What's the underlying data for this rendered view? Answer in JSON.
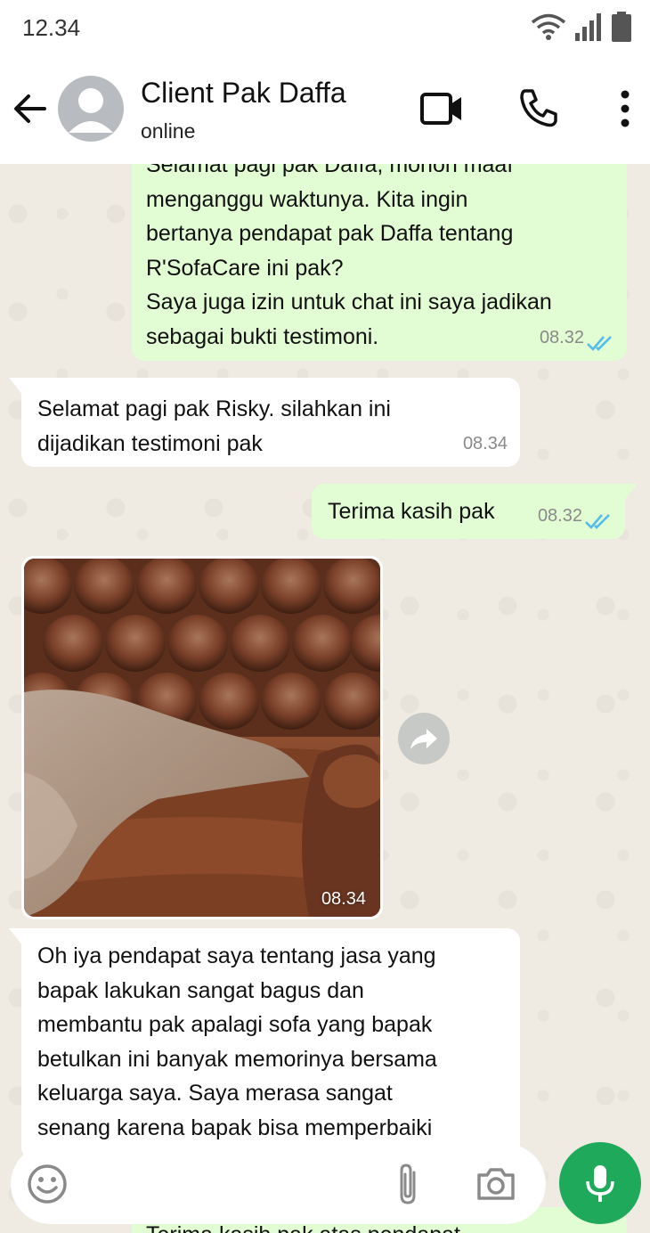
{
  "status_bar": {
    "time": "12.34",
    "icons": [
      "wifi-icon",
      "signal-icon",
      "battery-icon"
    ]
  },
  "header": {
    "contact_name": "Client Pak Daffa",
    "contact_status": "online",
    "icons": [
      "back-arrow-icon",
      "avatar-icon",
      "video-call-icon",
      "phone-call-icon",
      "more-vert-icon"
    ]
  },
  "messages": [
    {
      "direction": "outgoing",
      "lines": [
        "Selamat pagi pak Daffa, mohon maaf",
        "menganggu waktunya. Kita ingin",
        "bertanya pendapat pak Daffa tentang",
        "R'SofaCare ini pak?",
        "Saya juga izin untuk chat ini saya jadikan",
        "sebagai bukti testimoni."
      ],
      "time": "08.32",
      "read": true
    },
    {
      "direction": "incoming",
      "lines": [
        "Selamat pagi pak Risky. silahkan ini",
        "dijadikan testimoni pak"
      ],
      "time": "08.34"
    },
    {
      "direction": "outgoing",
      "lines": [
        "Terima kasih pak"
      ],
      "time": "08.32",
      "read": true
    },
    {
      "direction": "incoming",
      "type": "image",
      "image_subject": "brown tufted leather sofa with a beige throw blanket",
      "time": "08.34"
    },
    {
      "direction": "incoming",
      "lines": [
        "Oh iya pendapat saya tentang jasa yang",
        "bapak lakukan sangat bagus dan",
        "membantu pak apalagi  sofa yang bapak",
        "betulkan ini banyak memorinya bersama",
        "keluarga saya. Saya merasa sangat",
        "senang karena bapak bisa memperbaiki"
      ]
    },
    {
      "direction": "outgoing",
      "lines": [
        "Terima kasih pak atas pendapat"
      ]
    }
  ],
  "composer": {
    "icons": [
      "emoji-icon",
      "attachment-icon",
      "camera-icon",
      "microphone-icon"
    ]
  },
  "colors": {
    "outgoing_bubble": "#e2fcd3",
    "incoming_bubble": "#ffffff",
    "chat_background": "#efeae2",
    "read_tick": "#53bdeb",
    "mic_button": "#1faa5b"
  }
}
